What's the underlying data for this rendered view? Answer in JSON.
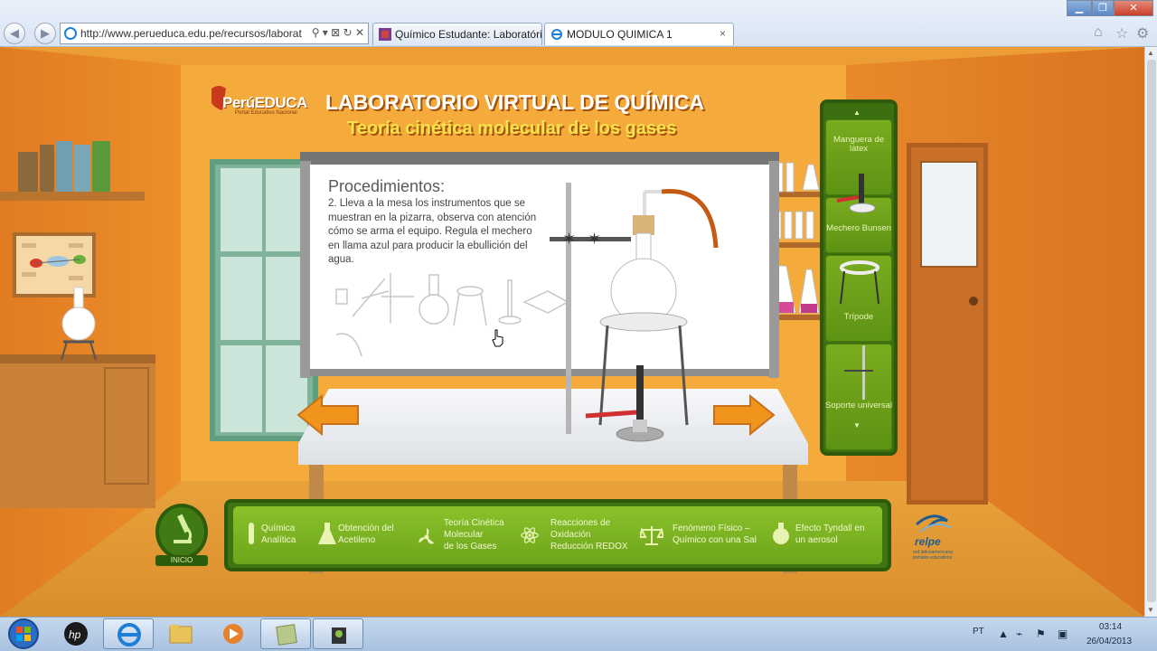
{
  "browser": {
    "address_url": "http://www.perueduca.edu.pe/recursos/laborat",
    "address_tools": "⚲ ▾ ⊠ ↻ ✕",
    "tabs": [
      {
        "label": "Químico Estudante: Laboratóri...",
        "active": false
      },
      {
        "label": "MODULO QUIMICA 1",
        "active": true
      }
    ],
    "close_tab_symbol": "×"
  },
  "header": {
    "logo_text": "PerúEDUCA",
    "logo_subtitle": "Portal Educativo Nacional",
    "title": "LABORATORIO VIRTUAL DE QUÍMICA",
    "subtitle": "Teoría cinética molecular de los gases"
  },
  "board": {
    "heading": "Procedimientos:",
    "text": "2. Lleva a la mesa los instrumentos que se muestran en la pizarra, observa con atención cómo se arma el equipo. Regula el mechero en llama azul para producir la ebullición del agua."
  },
  "equipment_panel": {
    "items": [
      {
        "label": "Manguera de látex"
      },
      {
        "label": "Mechero Bunsen"
      },
      {
        "label": "Trípode"
      },
      {
        "label": "Soporte universal"
      }
    ]
  },
  "bottom_menu": {
    "inicio": "INICIO",
    "items": [
      {
        "line1": "Química",
        "line2": "Analítica",
        "line3": ""
      },
      {
        "line1": "Obtención del",
        "line2": "Acetileno",
        "line3": ""
      },
      {
        "line1": "Teoría Cinética",
        "line2": "Molecular",
        "line3": "de los Gases"
      },
      {
        "line1": "Reacciones de",
        "line2": "Oxidación",
        "line3": "Reducción REDOX"
      },
      {
        "line1": "Fenómeno Físico –",
        "line2": "Químico con una Sal",
        "line3": ""
      },
      {
        "line1": "Efecto Tyndall en",
        "line2": "un aerosol",
        "line3": ""
      }
    ],
    "relpe_text": "relpe",
    "relpe_subtitle": "red latinoamericana portales educativos"
  },
  "taskbar": {
    "language": "PT",
    "time": "03:14",
    "date": "26/04/2013"
  },
  "colors": {
    "panel_green": "#3c6f10",
    "menu_green": "#7ab426",
    "title_yellow": "#f7e24a",
    "arrow_orange": "#f0941c",
    "wall_orange": "#f5ab3b"
  }
}
